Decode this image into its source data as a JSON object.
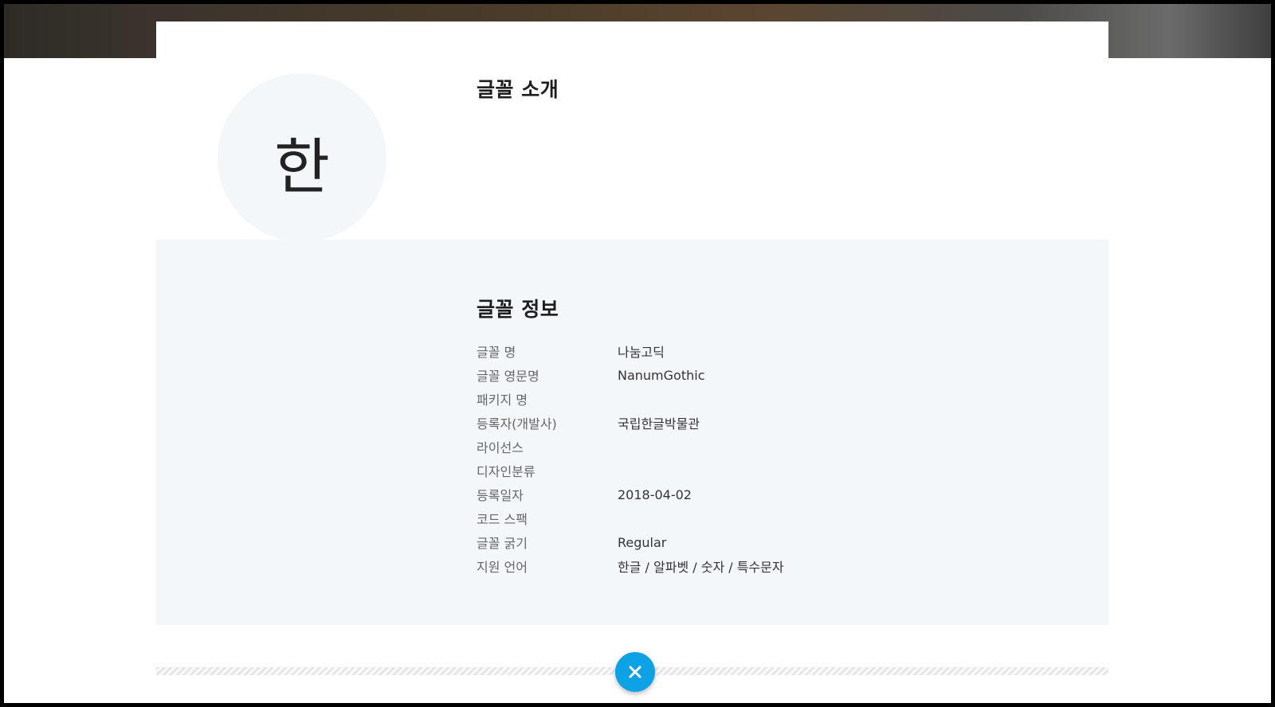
{
  "glyph_preview": "한",
  "intro": {
    "title": "글꼴 소개"
  },
  "info": {
    "title": "글꼴 정보",
    "rows": [
      {
        "label": "글꼴 명",
        "value": "나눔고딕"
      },
      {
        "label": "글꼴 영문명",
        "value": "NanumGothic"
      },
      {
        "label": "패키지 명",
        "value": ""
      },
      {
        "label": "등록자(개발사)",
        "value": "국립한글박물관"
      },
      {
        "label": "라이선스",
        "value": ""
      },
      {
        "label": "디자인분류",
        "value": ""
      },
      {
        "label": "등록일자",
        "value": "2018-04-02"
      },
      {
        "label": "코드 스팩",
        "value": ""
      },
      {
        "label": "글꼴 굵기",
        "value": "Regular"
      },
      {
        "label": "지원 언어",
        "value": "한글 / 알파벳 / 숫자 / 특수문자"
      }
    ]
  },
  "close_button": {
    "icon": "close-icon"
  },
  "colors": {
    "accent": "#0da1e5",
    "panel_bg": "#f4f7f9"
  }
}
